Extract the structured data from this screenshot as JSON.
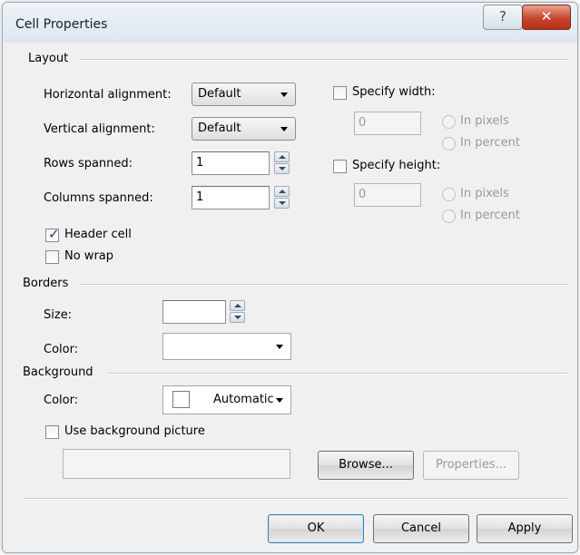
{
  "dialog": {
    "title": "Cell Properties",
    "help_glyph": "?",
    "close_glyph": "✕"
  },
  "layout": {
    "group_label": "Layout",
    "horizontal_alignment": {
      "label": "Horizontal alignment:",
      "value": "Default"
    },
    "vertical_alignment": {
      "label": "Vertical alignment:",
      "value": "Default"
    },
    "rows_spanned": {
      "label": "Rows spanned:",
      "value": "1"
    },
    "columns_spanned": {
      "label": "Columns spanned:",
      "value": "1"
    },
    "header_cell": {
      "label": "Header cell",
      "checked": true
    },
    "no_wrap": {
      "label": "No wrap",
      "checked": false
    },
    "specify_width": {
      "label": "Specify width:",
      "checked": false,
      "value": "0",
      "option_pixels": "In pixels",
      "option_percent": "In percent"
    },
    "specify_height": {
      "label": "Specify height:",
      "checked": false,
      "value": "0",
      "option_pixels": "In pixels",
      "option_percent": "In percent"
    }
  },
  "borders": {
    "group_label": "Borders",
    "size_label": "Size:",
    "size_value": "",
    "color_label": "Color:",
    "color_value": ""
  },
  "background": {
    "group_label": "Background",
    "color_label": "Color:",
    "color_value": "Automatic",
    "use_picture": {
      "label": "Use background picture",
      "checked": false
    },
    "picture_path": "",
    "browse_label": "Browse...",
    "properties_label": "Properties..."
  },
  "footer": {
    "ok_label": "OK",
    "cancel_label": "Cancel",
    "apply_label": "Apply"
  },
  "icons": {
    "check_glyph": "✓",
    "dropdown": "caret-down-icon",
    "spinner": "up-down-arrow-icons"
  }
}
